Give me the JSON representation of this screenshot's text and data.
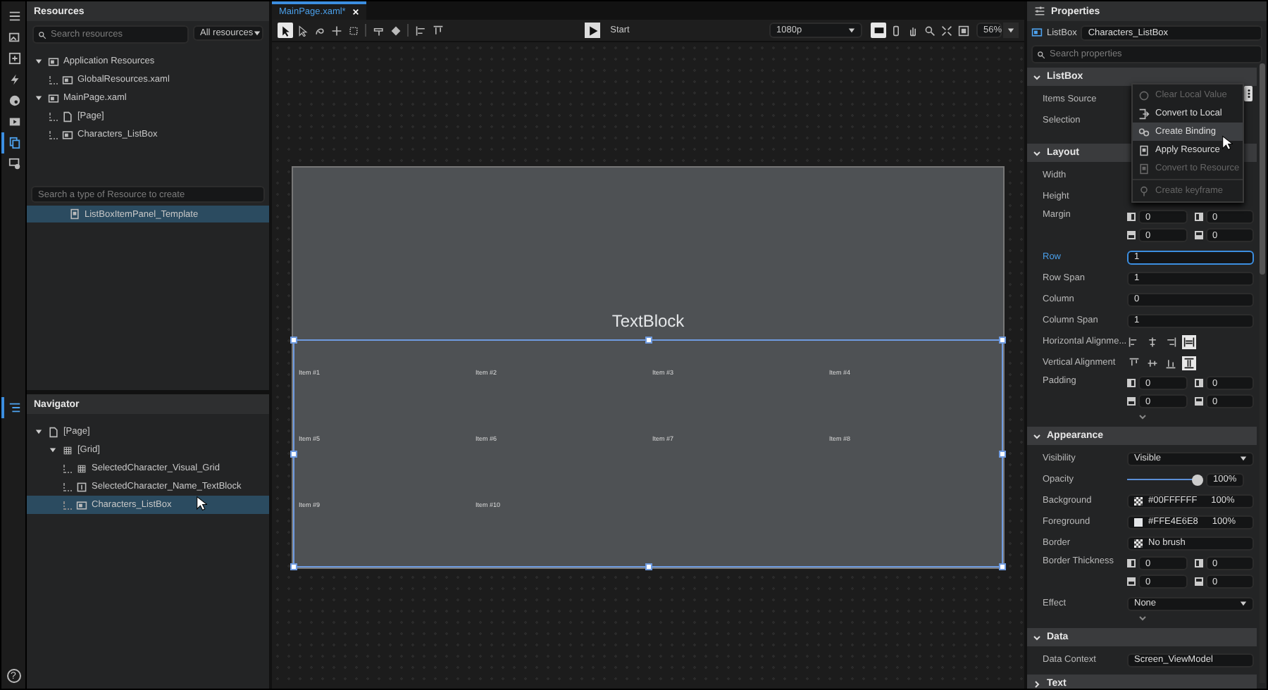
{
  "rail": [
    {
      "kind": "menu",
      "selected": false
    },
    {
      "kind": "assets",
      "selected": false
    },
    {
      "kind": "add",
      "selected": false
    },
    {
      "kind": "events",
      "selected": false
    },
    {
      "kind": "themes",
      "selected": false
    },
    {
      "kind": "media",
      "selected": false
    },
    {
      "kind": "resources",
      "selected": true
    },
    {
      "kind": "data",
      "selected": false
    }
  ],
  "rail_lower": [
    {
      "kind": "navigator",
      "selected": true
    }
  ],
  "help": "?",
  "resources": {
    "title": "Resources",
    "search_placeholder": "Search resources",
    "filter": "All resources",
    "tree": [
      {
        "label": "Application Resources",
        "kind": "folder",
        "expanded": true,
        "children": [
          {
            "label": "GlobalResources.xaml",
            "kind": "dictionary"
          }
        ]
      },
      {
        "label": "MainPage.xaml",
        "kind": "folder",
        "expanded": true,
        "children": [
          {
            "label": "[Page]",
            "kind": "page"
          },
          {
            "label": "Characters_ListBox",
            "kind": "listbox"
          }
        ]
      }
    ],
    "create_placeholder": "Search a type of Resource to create",
    "items": [
      {
        "label": "ListBoxItemPanel_Template",
        "selected": true
      }
    ]
  },
  "navigator": {
    "title": "Navigator",
    "tree": [
      {
        "label": "[Page]",
        "kind": "page",
        "selected": false,
        "expanded": true,
        "children": [
          {
            "label": "[Grid]",
            "kind": "grid",
            "selected": false,
            "expanded": true,
            "children": [
              {
                "label": "SelectedCharacter_Visual_Grid",
                "kind": "grid",
                "selected": false
              },
              {
                "label": "SelectedCharacter_Name_TextBlock",
                "kind": "text",
                "selected": false
              },
              {
                "label": "Characters_ListBox",
                "kind": "listbox",
                "selected": true
              }
            ]
          }
        ]
      }
    ]
  },
  "document_tab": {
    "label": "MainPage.xaml*",
    "selected": true
  },
  "toolbar": {
    "tools": [
      {
        "kind": "select",
        "selected": true
      },
      {
        "kind": "direct",
        "selected": false
      },
      {
        "kind": "pen",
        "selected": false
      },
      {
        "kind": "move",
        "selected": false
      },
      {
        "kind": "transform",
        "selected": false
      },
      {
        "kind": "paint",
        "selected": false
      },
      {
        "kind": "fill",
        "selected": false
      },
      {
        "kind": "align_left",
        "selected": false
      },
      {
        "kind": "align_top",
        "selected": false
      }
    ],
    "run_label": "Start",
    "resolution": "1080p",
    "devices": [
      {
        "kind": "desktop",
        "selected": true
      },
      {
        "kind": "phone",
        "selected": false
      }
    ],
    "view_tools": [
      {
        "kind": "pan"
      },
      {
        "kind": "zoom"
      },
      {
        "kind": "fit"
      },
      {
        "kind": "fill_screen"
      }
    ],
    "zoom": "56%"
  },
  "artboard": {
    "textblock": "TextBlock",
    "items": [
      "Item #1",
      "Item #2",
      "Item #3",
      "Item #4",
      "Item #5",
      "Item #6",
      "Item #7",
      "Item #8",
      "Item #9",
      "Item #10"
    ]
  },
  "properties": {
    "title": "Properties",
    "type": "ListBox",
    "name": "Characters_ListBox",
    "search_placeholder": "Search properties",
    "sections": [
      {
        "title": "ListBox",
        "expanded": true,
        "rows": [
          {
            "label": "Items Source",
            "kind": "covered"
          },
          {
            "label": "Selection",
            "kind": "covered"
          }
        ]
      },
      {
        "title": "Layout",
        "expanded": true,
        "more": true,
        "rows": [
          {
            "label": "Width",
            "kind": "covered"
          },
          {
            "label": "Height",
            "kind": "covered"
          },
          {
            "label": "Margin",
            "kind": "thickness",
            "values": [
              "0",
              "0",
              "0",
              "0"
            ]
          },
          {
            "label": "Row",
            "kind": "field",
            "value": "1",
            "focused": true
          },
          {
            "label": "Row Span",
            "kind": "field",
            "value": "1",
            "focused": false
          },
          {
            "label": "Column",
            "kind": "field",
            "value": "0",
            "focused": false
          },
          {
            "label": "Column Span",
            "kind": "field",
            "value": "1",
            "focused": false
          },
          {
            "label": "Horizontal Alignme...",
            "kind": "halign",
            "options": [
              {
                "selected": false
              },
              {
                "selected": false
              },
              {
                "selected": false
              },
              {
                "selected": true
              }
            ]
          },
          {
            "label": "Vertical Alignment",
            "kind": "valign",
            "options": [
              {
                "selected": false
              },
              {
                "selected": false
              },
              {
                "selected": false
              },
              {
                "selected": true
              }
            ]
          },
          {
            "label": "Padding",
            "kind": "thickness",
            "values": [
              "0",
              "0",
              "0",
              "0"
            ]
          }
        ]
      },
      {
        "title": "Appearance",
        "expanded": true,
        "more": true,
        "rows": [
          {
            "label": "Visibility",
            "kind": "select",
            "value": "Visible"
          },
          {
            "label": "Opacity",
            "kind": "slider",
            "level": 1,
            "reading": "100%"
          },
          {
            "label": "Background",
            "kind": "brush",
            "value": "#00FFFFFF",
            "reading": "100%"
          },
          {
            "label": "Foreground",
            "kind": "brush",
            "color": "#e4e6e8",
            "value": "#FFE4E6E8",
            "reading": "100%"
          },
          {
            "label": "Border",
            "kind": "brush",
            "value": "No brush"
          },
          {
            "label": "Border Thickness",
            "kind": "thickness",
            "values": [
              "0",
              "0",
              "0",
              "0"
            ]
          },
          {
            "label": "Effect",
            "kind": "select",
            "value": "None"
          }
        ]
      },
      {
        "title": "Data",
        "expanded": true,
        "rows": [
          {
            "label": "Data Context",
            "kind": "field",
            "value": "Screen_ViewModel",
            "focused": false
          }
        ]
      },
      {
        "title": "Text",
        "expanded": false
      }
    ]
  },
  "context_menu": {
    "items": [
      {
        "label": "Clear Local Value",
        "kind": "clear",
        "disabled": true,
        "selected": false
      },
      {
        "label": "Convert to Local",
        "kind": "local",
        "disabled": false,
        "selected": false
      },
      {
        "label": "Create Binding",
        "kind": "binding",
        "disabled": false,
        "selected": true
      },
      {
        "label": "Apply Resource",
        "kind": "resource",
        "disabled": false,
        "selected": false
      },
      {
        "label": "Convert to Resource",
        "kind": "resource",
        "disabled": true,
        "selected": false
      },
      {
        "label": "Create keyframe",
        "kind": "keyframe",
        "disabled": true,
        "selected": false
      }
    ]
  }
}
